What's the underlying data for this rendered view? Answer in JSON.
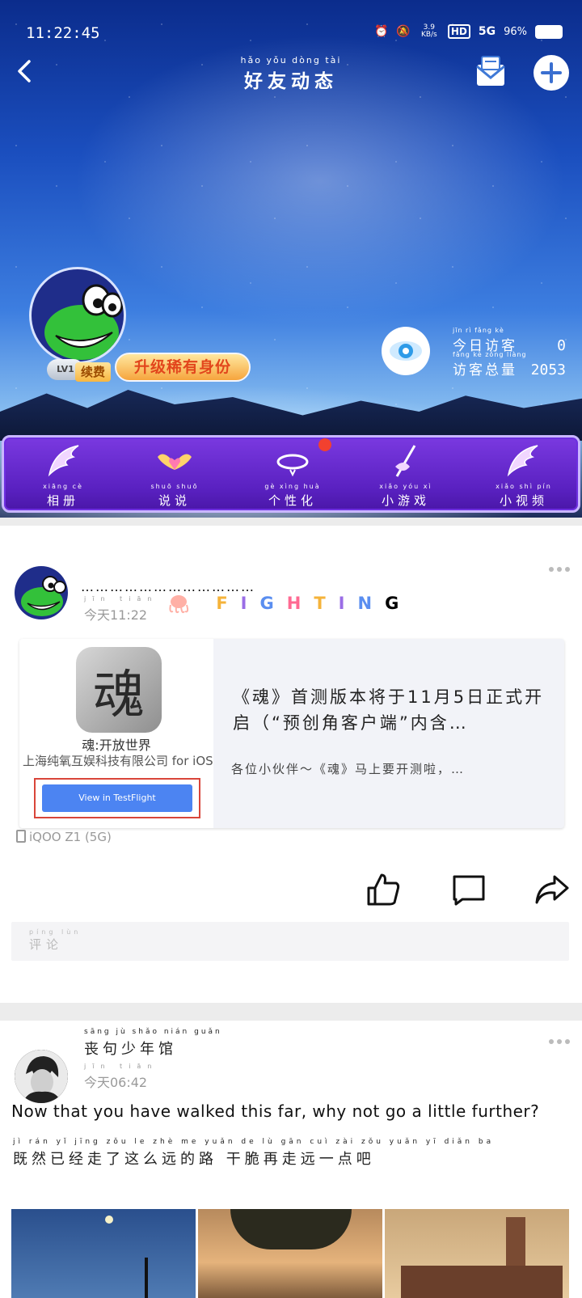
{
  "status_bar": {
    "time": "11:22:45",
    "net_speed": "3.9 KB/s",
    "hd": "HD",
    "signal": "5G",
    "battery": "96%"
  },
  "header": {
    "title_pinyin": "hǎo yǒu dòng tài",
    "title": "好友动态"
  },
  "profile": {
    "level": "LV1",
    "renew_label": "续费",
    "upgrade_label": "升级稀有身份",
    "today_visitors_pinyin": "jīn rì fǎng kè",
    "today_visitors_label": "今日访客",
    "today_visitors": "0",
    "total_visitors_pinyin": "fǎng kè zǒng liàng",
    "total_visitors_label": "访客总量",
    "total_visitors": "2053"
  },
  "tabs": [
    {
      "pinyin": "xiāng cè",
      "label": "相册"
    },
    {
      "pinyin": "shuō shuō",
      "label": "说说"
    },
    {
      "pinyin": "gè xìng huà",
      "label": "个性化"
    },
    {
      "pinyin": "xiǎo yóu xì",
      "label": "小游戏"
    },
    {
      "pinyin": "xiǎo shì pín",
      "label": "小视频"
    }
  ],
  "post1": {
    "author": "………………………………",
    "time_pinyin": "jīn tiān",
    "time": "今天11:22",
    "signature": [
      "F",
      "I",
      "G",
      "H",
      "T",
      "I",
      "N",
      "G"
    ],
    "share": {
      "app_name": "魂:开放世界",
      "company": "上海纯氧互娱科技有限公司 for iOS",
      "button": "View in TestFlight",
      "title": "《魂》首测版本将于11月5日正式开启（“预创角客户端”内含…",
      "desc": "各位小伙伴～《魂》马上要开测啦，…"
    },
    "device": "iQOO Z1 (5G)",
    "comment_pinyin": "píng lùn",
    "comment_placeholder": "评论"
  },
  "post2": {
    "author_pinyin": "sāng jù shǎo nián guǎn",
    "author": "丧句少年馆",
    "time_pinyin": "jīn tiān",
    "time": "今天06:42",
    "quote_en": "Now that you have walked this far, why not go a little further?",
    "quote_cn_pinyin": "jì rán yǐ jīng zǒu le zhè me yuǎn de lù   gān cuì zài zǒu yuǎn yī diǎn ba",
    "quote_cn": "既然已经走了这么远的路    干脆再走远一点吧"
  },
  "colors": {
    "tab_bar": "#5a21c1",
    "accent_blue": "#4c84f2",
    "badge_red": "#f2412f"
  }
}
